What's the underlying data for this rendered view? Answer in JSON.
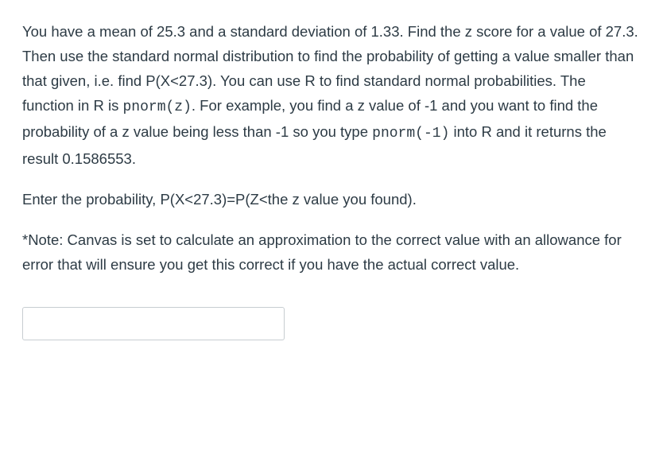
{
  "question": {
    "p1_a": "You have a mean of 25.3 and a standard deviation of 1.33.  Find the z score for a value of 27.3.  Then use the standard normal distribution to find the probability of getting a value smaller than that given, i.e. find P(X<27.3).  You can use R to find standard normal probabilities.  The function in R is ",
    "code1": "pnorm(z)",
    "p1_b": ".  For example, you find a z value of -1 and you want to find the probability of a z value being less than -1 so you type ",
    "code2": "pnorm(-1)",
    "p1_c": " into R and it returns the result 0.1586553.",
    "p2": "Enter the probability, P(X<27.3)=P(Z<the z value you found).",
    "p3": "*Note: Canvas is set to calculate an approximation to the correct value with an allowance for error that will ensure you get this correct if you have the actual correct value."
  },
  "input": {
    "value": "",
    "placeholder": ""
  }
}
